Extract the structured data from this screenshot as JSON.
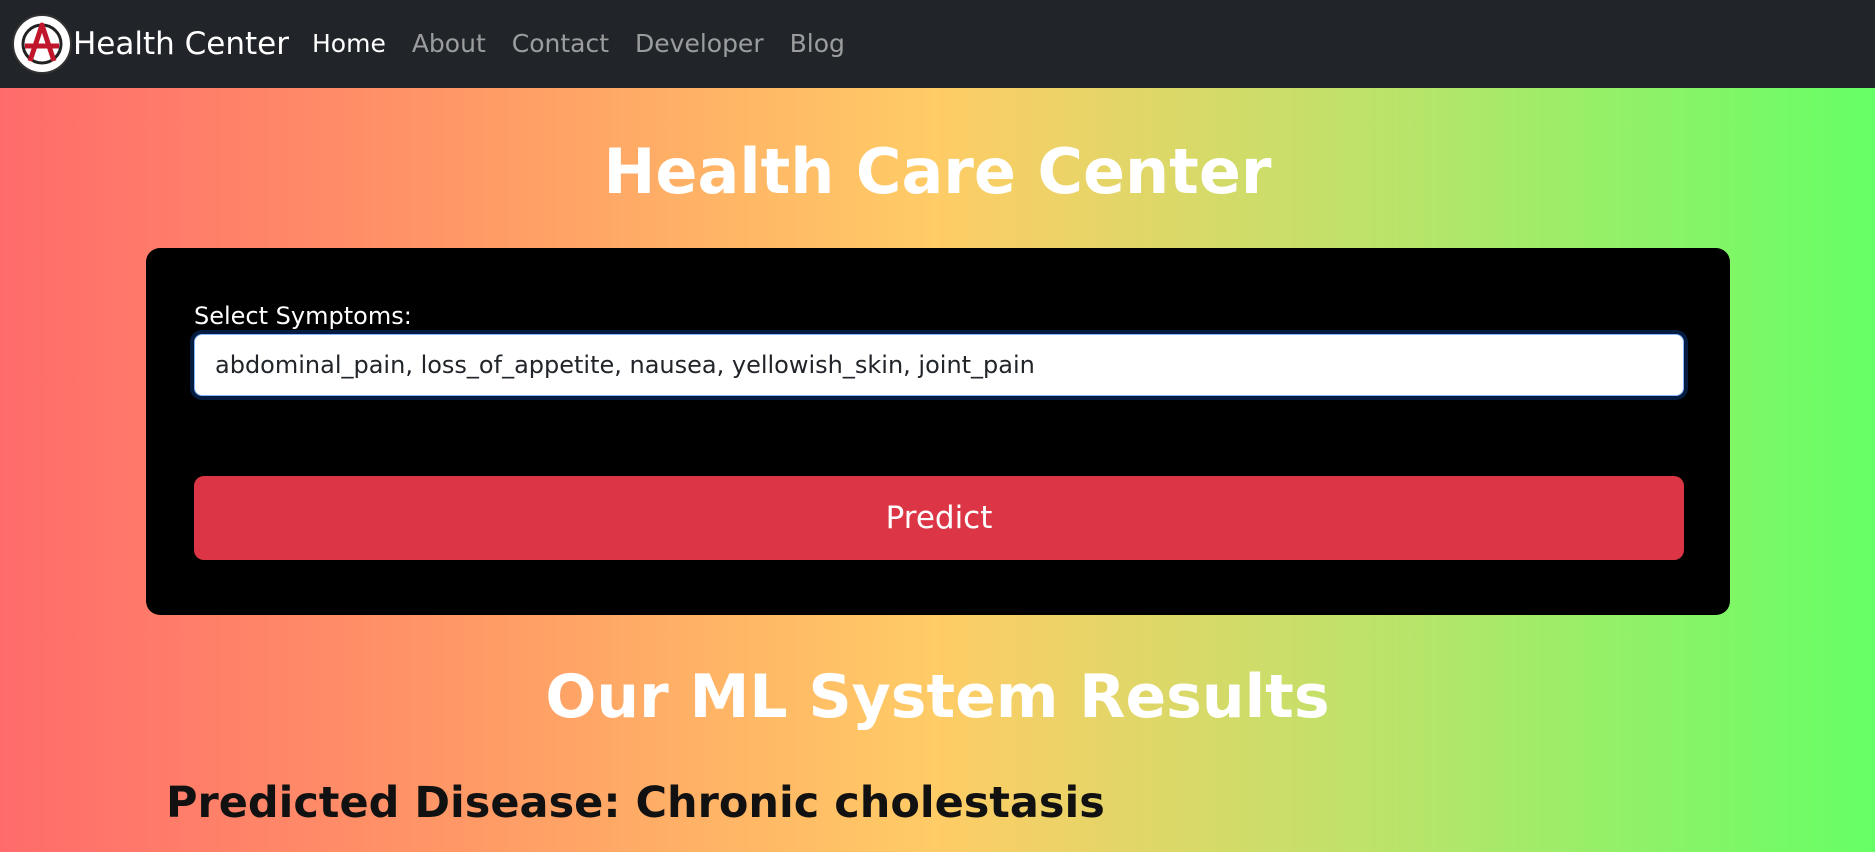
{
  "navbar": {
    "brand": "Health Center",
    "logo_icon": "anarchy-a-logo-icon",
    "links": [
      "Home",
      "About",
      "Contact",
      "Developer",
      "Blog"
    ],
    "active": "Home"
  },
  "main": {
    "title": "Health Care Center",
    "form": {
      "label": "Select Symptoms:",
      "symptoms_value": "abdominal_pain, loss_of_appetite, nausea, yellowish_skin, joint_pain",
      "predict_label": "Predict"
    },
    "results_title": "Our ML System Results",
    "prediction": "Predicted Disease: Chronic cholestasis"
  },
  "colors": {
    "navbar": "#212529",
    "predict_button": "#dc3545",
    "panel": "#000000",
    "gradient": [
      "#ff6b6b",
      "#ff9966",
      "#ffcc66",
      "#b8e46a",
      "#66ff66"
    ]
  }
}
